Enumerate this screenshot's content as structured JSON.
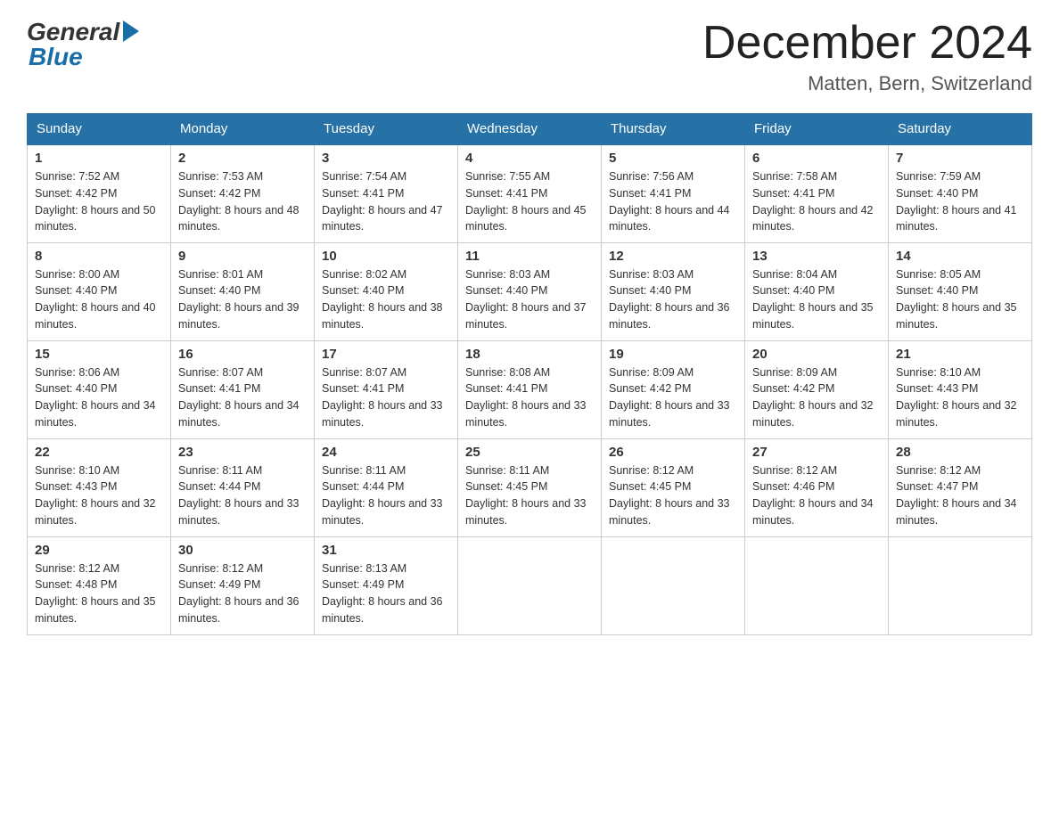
{
  "header": {
    "logo_general": "General",
    "logo_blue": "Blue",
    "month_title": "December 2024",
    "location": "Matten, Bern, Switzerland"
  },
  "days_of_week": [
    "Sunday",
    "Monday",
    "Tuesday",
    "Wednesday",
    "Thursday",
    "Friday",
    "Saturday"
  ],
  "weeks": [
    [
      {
        "day": "1",
        "sunrise": "7:52 AM",
        "sunset": "4:42 PM",
        "daylight": "8 hours and 50 minutes."
      },
      {
        "day": "2",
        "sunrise": "7:53 AM",
        "sunset": "4:42 PM",
        "daylight": "8 hours and 48 minutes."
      },
      {
        "day": "3",
        "sunrise": "7:54 AM",
        "sunset": "4:41 PM",
        "daylight": "8 hours and 47 minutes."
      },
      {
        "day": "4",
        "sunrise": "7:55 AM",
        "sunset": "4:41 PM",
        "daylight": "8 hours and 45 minutes."
      },
      {
        "day": "5",
        "sunrise": "7:56 AM",
        "sunset": "4:41 PM",
        "daylight": "8 hours and 44 minutes."
      },
      {
        "day": "6",
        "sunrise": "7:58 AM",
        "sunset": "4:41 PM",
        "daylight": "8 hours and 42 minutes."
      },
      {
        "day": "7",
        "sunrise": "7:59 AM",
        "sunset": "4:40 PM",
        "daylight": "8 hours and 41 minutes."
      }
    ],
    [
      {
        "day": "8",
        "sunrise": "8:00 AM",
        "sunset": "4:40 PM",
        "daylight": "8 hours and 40 minutes."
      },
      {
        "day": "9",
        "sunrise": "8:01 AM",
        "sunset": "4:40 PM",
        "daylight": "8 hours and 39 minutes."
      },
      {
        "day": "10",
        "sunrise": "8:02 AM",
        "sunset": "4:40 PM",
        "daylight": "8 hours and 38 minutes."
      },
      {
        "day": "11",
        "sunrise": "8:03 AM",
        "sunset": "4:40 PM",
        "daylight": "8 hours and 37 minutes."
      },
      {
        "day": "12",
        "sunrise": "8:03 AM",
        "sunset": "4:40 PM",
        "daylight": "8 hours and 36 minutes."
      },
      {
        "day": "13",
        "sunrise": "8:04 AM",
        "sunset": "4:40 PM",
        "daylight": "8 hours and 35 minutes."
      },
      {
        "day": "14",
        "sunrise": "8:05 AM",
        "sunset": "4:40 PM",
        "daylight": "8 hours and 35 minutes."
      }
    ],
    [
      {
        "day": "15",
        "sunrise": "8:06 AM",
        "sunset": "4:40 PM",
        "daylight": "8 hours and 34 minutes."
      },
      {
        "day": "16",
        "sunrise": "8:07 AM",
        "sunset": "4:41 PM",
        "daylight": "8 hours and 34 minutes."
      },
      {
        "day": "17",
        "sunrise": "8:07 AM",
        "sunset": "4:41 PM",
        "daylight": "8 hours and 33 minutes."
      },
      {
        "day": "18",
        "sunrise": "8:08 AM",
        "sunset": "4:41 PM",
        "daylight": "8 hours and 33 minutes."
      },
      {
        "day": "19",
        "sunrise": "8:09 AM",
        "sunset": "4:42 PM",
        "daylight": "8 hours and 33 minutes."
      },
      {
        "day": "20",
        "sunrise": "8:09 AM",
        "sunset": "4:42 PM",
        "daylight": "8 hours and 32 minutes."
      },
      {
        "day": "21",
        "sunrise": "8:10 AM",
        "sunset": "4:43 PM",
        "daylight": "8 hours and 32 minutes."
      }
    ],
    [
      {
        "day": "22",
        "sunrise": "8:10 AM",
        "sunset": "4:43 PM",
        "daylight": "8 hours and 32 minutes."
      },
      {
        "day": "23",
        "sunrise": "8:11 AM",
        "sunset": "4:44 PM",
        "daylight": "8 hours and 33 minutes."
      },
      {
        "day": "24",
        "sunrise": "8:11 AM",
        "sunset": "4:44 PM",
        "daylight": "8 hours and 33 minutes."
      },
      {
        "day": "25",
        "sunrise": "8:11 AM",
        "sunset": "4:45 PM",
        "daylight": "8 hours and 33 minutes."
      },
      {
        "day": "26",
        "sunrise": "8:12 AM",
        "sunset": "4:45 PM",
        "daylight": "8 hours and 33 minutes."
      },
      {
        "day": "27",
        "sunrise": "8:12 AM",
        "sunset": "4:46 PM",
        "daylight": "8 hours and 34 minutes."
      },
      {
        "day": "28",
        "sunrise": "8:12 AM",
        "sunset": "4:47 PM",
        "daylight": "8 hours and 34 minutes."
      }
    ],
    [
      {
        "day": "29",
        "sunrise": "8:12 AM",
        "sunset": "4:48 PM",
        "daylight": "8 hours and 35 minutes."
      },
      {
        "day": "30",
        "sunrise": "8:12 AM",
        "sunset": "4:49 PM",
        "daylight": "8 hours and 36 minutes."
      },
      {
        "day": "31",
        "sunrise": "8:13 AM",
        "sunset": "4:49 PM",
        "daylight": "8 hours and 36 minutes."
      },
      null,
      null,
      null,
      null
    ]
  ]
}
